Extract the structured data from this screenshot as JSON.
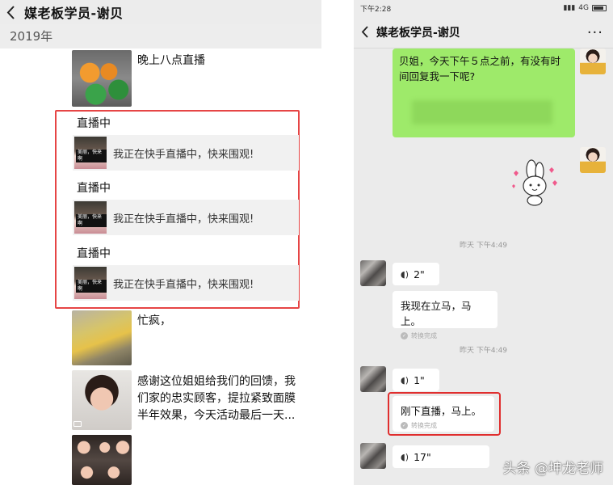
{
  "left": {
    "title": "媒老板学员-谢贝",
    "year": "2019年",
    "post1_text": "晚上八点直播",
    "live_blocks": [
      {
        "title": "直播中",
        "thumb_tag": "美丽，快来啊",
        "message": "我正在快手直播中，快来围观!"
      },
      {
        "title": "直播中",
        "thumb_tag": "美丽，快来啊",
        "message": "我正在快手直播中，快来围观!"
      },
      {
        "title": "直播中",
        "thumb_tag": "美丽，快来啊",
        "message": "我正在快手直播中，快来围观!"
      }
    ],
    "post2_text": "忙疯，",
    "post3_text_line1": "感谢这位姐姐给我们的回馈，我",
    "post3_text_line2": "们家的忠实顾客，提拉紧致面膜",
    "post3_text_line3": "半年效果，今天活动最后一天..."
  },
  "right": {
    "status_time": "下午2:28",
    "status_network": "4G",
    "title": "媒老板学员-谢贝",
    "more": "···",
    "msg1_line1": "贝姐，今天下午５点之前，有没有时",
    "msg1_line2": "间回复我一下呢?",
    "timestamp1": "昨天 下午4:49",
    "voice1": "2\"",
    "reply1": "我现在立马，马上。",
    "reply1_status": "转换完成",
    "timestamp2": "昨天 下午4:49",
    "voice2": "1\"",
    "reply2": "刚下直播，马上。",
    "reply2_status": "转换完成",
    "voice3": "17\""
  },
  "watermark": "头条 @坤龙老师",
  "colors": {
    "green_bubble": "#9eea6a",
    "highlight_red": "#e02e2e"
  }
}
